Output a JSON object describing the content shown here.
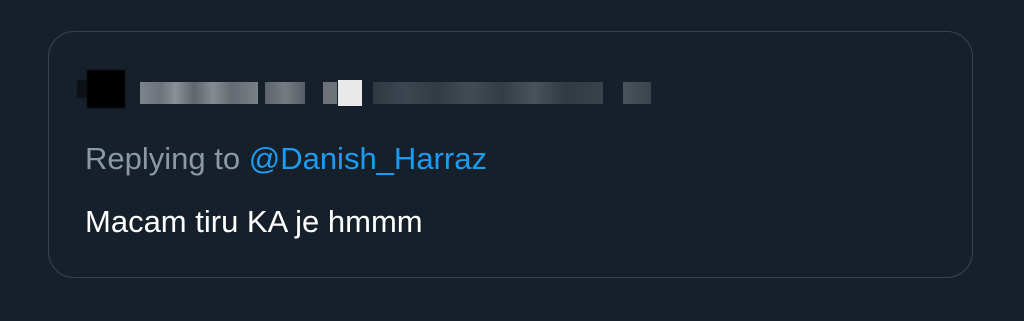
{
  "quoted_tweet": {
    "replying_prefix": "Replying to",
    "reply_to_handle": "@Danish_Harraz",
    "text": "Macam tiru KA je hmmm"
  },
  "colors": {
    "background": "#15202b",
    "card_border": "#38444d",
    "secondary_text": "#8b98a5",
    "mention": "#1d9bf0",
    "primary_text": "#ffffff"
  },
  "icons": {
    "avatar": "avatar",
    "verified_badge": "verified-badge-icon"
  }
}
